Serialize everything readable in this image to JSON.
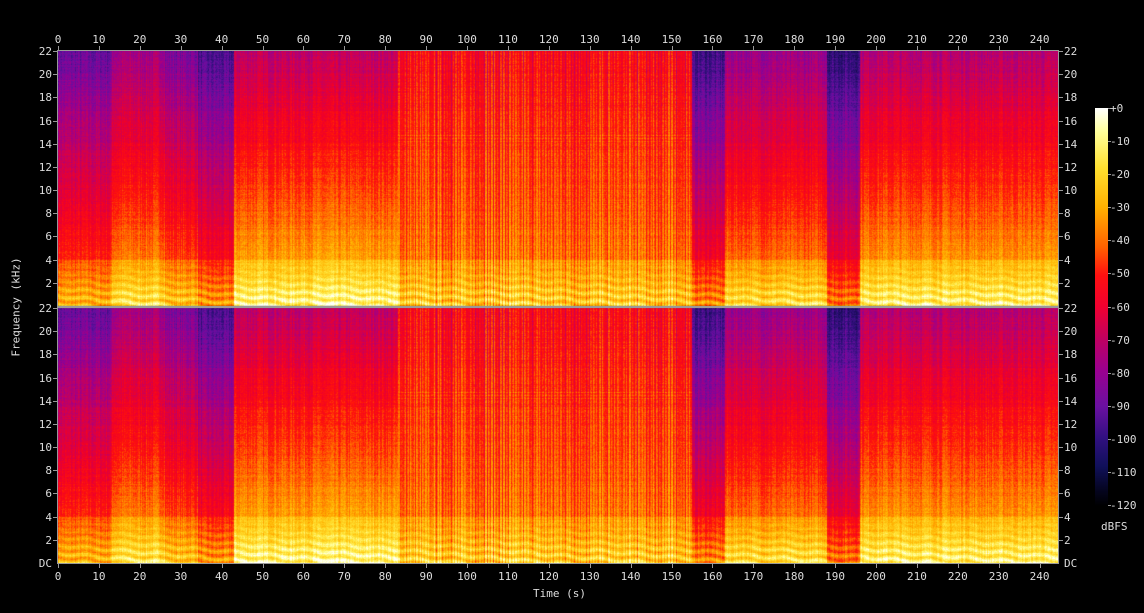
{
  "chart_data": {
    "type": "heatmap",
    "title": "",
    "xlabel": "Time (s)",
    "ylabel": "Frequency (kHz)",
    "xlim": [
      0,
      245
    ],
    "ylim": [
      0,
      22
    ],
    "x_ticks": [
      "0",
      "10",
      "20",
      "30",
      "40",
      "50",
      "60",
      "70",
      "80",
      "90",
      "100",
      "110",
      "120",
      "130",
      "140",
      "150",
      "160",
      "170",
      "180",
      "190",
      "200",
      "210",
      "220",
      "230",
      "240"
    ],
    "y_ticks": [
      "22",
      "20",
      "18",
      "16",
      "14",
      "12",
      "10",
      "8",
      "6",
      "4",
      "2"
    ],
    "y_zero_label": "DC",
    "channels": 2,
    "colorbar": {
      "label": "dBFS",
      "ticks": [
        "+0",
        "-10",
        "-20",
        "-30",
        "-40",
        "-50",
        "-60",
        "-70",
        "-80",
        "-90",
        "-100",
        "-110",
        "-120"
      ],
      "range": [
        -120,
        0
      ]
    },
    "segments_s_dBFS_at_22kHz": [
      [
        0,
        13,
        -90
      ],
      [
        13,
        26,
        -78
      ],
      [
        26,
        34,
        -86
      ],
      [
        34,
        43,
        -96
      ],
      [
        43,
        83,
        -72
      ],
      [
        83,
        155,
        -52
      ],
      [
        155,
        163,
        -98
      ],
      [
        163,
        188,
        -80
      ],
      [
        188,
        196,
        -100
      ],
      [
        196,
        245,
        -74
      ]
    ]
  }
}
